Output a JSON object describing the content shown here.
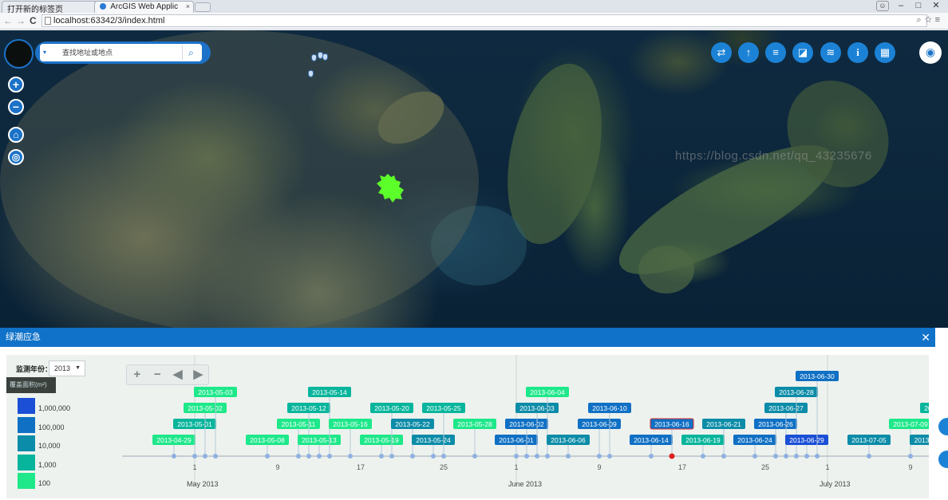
{
  "browser": {
    "tabs": [
      {
        "label": "打开新的标签页",
        "close": "×"
      },
      {
        "label": "ArcGIS Web Applic",
        "close": "×"
      }
    ],
    "url": "localhost:63342/3/index.html",
    "window_controls": [
      "–",
      "□",
      "✕"
    ],
    "user_icon": "☺",
    "nav_back": "←",
    "nav_forward": "→",
    "nav_reload": "C",
    "addr_right_icons": "⌕☆≡"
  },
  "map": {
    "search": {
      "placeholder": "查找地址或地点",
      "dropdown_icon": "▾",
      "search_icon": "⌕"
    },
    "zoom_in": "+",
    "zoom_out": "−",
    "home_icon": "⌂",
    "locate_icon": "◎",
    "toolbar": [
      {
        "name": "swipe-icon",
        "glyph": "⇄"
      },
      {
        "name": "upload-icon",
        "glyph": "↑"
      },
      {
        "name": "legend-icon",
        "glyph": "≡"
      },
      {
        "name": "basemap-icon",
        "glyph": "◪"
      },
      {
        "name": "layers-icon",
        "glyph": "≋"
      },
      {
        "name": "info-icon",
        "glyph": "i"
      },
      {
        "name": "grid-icon",
        "glyph": "▦"
      }
    ],
    "eye_icon": "◉",
    "bloom_color": "#5cff2a"
  },
  "panel": {
    "title": "绿潮应急",
    "close": "✕",
    "year_label": "监测年份：",
    "year_value": "2013",
    "year_caret": "▼",
    "legend_title": "覆盖面积(m²)",
    "legend": [
      {
        "label": "1,000,000",
        "color": "#1a4fd6"
      },
      {
        "label": "100,000",
        "color": "#0f70c4"
      },
      {
        "label": "10,000",
        "color": "#0b8ca8"
      },
      {
        "label": "1,000",
        "color": "#07b59c"
      },
      {
        "label": "100",
        "color": "#1ee88a"
      }
    ],
    "timeline_controls": [
      "+",
      "−",
      "◀",
      "▶"
    ],
    "timeline": {
      "months": [
        "May 2013",
        "June 2013",
        "July 2013"
      ],
      "day_ticks": [
        "1",
        "9",
        "17",
        "25",
        "1",
        "9",
        "17",
        "25",
        "1",
        "9"
      ],
      "events": [
        {
          "date": "2013-04-29",
          "level": 4
        },
        {
          "date": "2013-05-01",
          "level": 3
        },
        {
          "date": "2013-05-02",
          "level": 4
        },
        {
          "date": "2013-05-03",
          "level": 4
        },
        {
          "date": "2013-05-08",
          "level": 4
        },
        {
          "date": "2013-05-11",
          "level": 4
        },
        {
          "date": "2013-05-12",
          "level": 3
        },
        {
          "date": "2013-05-13",
          "level": 4
        },
        {
          "date": "2013-05-14",
          "level": 3
        },
        {
          "date": "2013-05-16",
          "level": 4
        },
        {
          "date": "2013-05-19",
          "level": 4
        },
        {
          "date": "2013-05-20",
          "level": 3
        },
        {
          "date": "2013-05-22",
          "level": 2
        },
        {
          "date": "2013-05-24",
          "level": 2
        },
        {
          "date": "2013-05-25",
          "level": 3
        },
        {
          "date": "2013-05-28",
          "level": 4
        },
        {
          "date": "2013-06-01",
          "level": 1
        },
        {
          "date": "2013-06-02",
          "level": 1
        },
        {
          "date": "2013-06-03",
          "level": 2
        },
        {
          "date": "2013-06-04",
          "level": 4
        },
        {
          "date": "2013-06-06",
          "level": 2
        },
        {
          "date": "2013-06-09",
          "level": 1
        },
        {
          "date": "2013-06-10",
          "level": 1
        },
        {
          "date": "2013-06-14",
          "level": 1
        },
        {
          "date": "2013-06-16",
          "level": 1,
          "selected": true
        },
        {
          "date": "2013-06-19",
          "level": 3
        },
        {
          "date": "2013-06-21",
          "level": 2
        },
        {
          "date": "2013-06-24",
          "level": 1
        },
        {
          "date": "2013-06-26",
          "level": 1
        },
        {
          "date": "2013-06-27",
          "level": 2
        },
        {
          "date": "2013-06-28",
          "level": 2
        },
        {
          "date": "2013-06-29",
          "level": 0
        },
        {
          "date": "2013-06-30",
          "level": 1
        },
        {
          "date": "2013-07-05",
          "level": 2
        },
        {
          "date": "2013-07-09",
          "level": 4
        },
        {
          "date": "2013-07-11",
          "level": 2
        },
        {
          "date": "2013-07-12",
          "level": 3
        },
        {
          "date": "2013-07-13",
          "level": 3
        }
      ]
    }
  },
  "watermark": "https://blog.csdn.net/qq_43235676"
}
